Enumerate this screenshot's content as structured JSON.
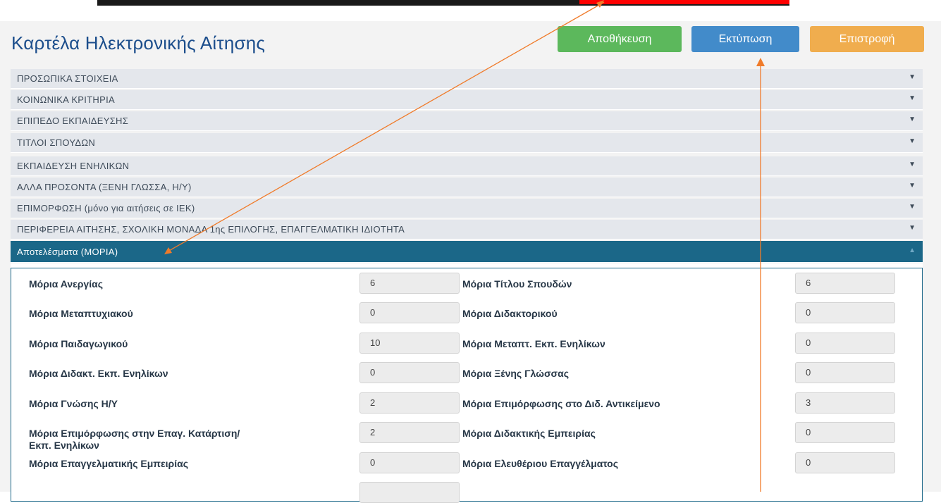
{
  "page": {
    "title": "Καρτέλα Ηλεκτρονικής Αίτησης"
  },
  "toolbar": {
    "save_label": "Αποθήκευση",
    "print_label": "Εκτύπωση",
    "back_label": "Επιστροφή"
  },
  "sections": [
    {
      "label": "ΠΡΟΣΩΠΙΚΑ ΣΤΟΙΧΕΙΑ"
    },
    {
      "label": "ΚΟΙΝΩΝΙΚΑ ΚΡΙΤΗΡΙΑ"
    },
    {
      "label": "ΕΠΙΠΕΔΟ ΕΚΠΑΙΔΕΥΣΗΣ"
    },
    {
      "label": "ΤΙΤΛΟΙ ΣΠΟΥΔΩΝ"
    },
    {
      "label": "ΕΚΠΑΙΔΕΥΣΗ ΕΝΗΛΙΚΩΝ"
    },
    {
      "label": "ΑΛΛΑ ΠΡΟΣΟΝΤΑ (ΞΕΝΗ ΓΛΩΣΣΑ, Η/Υ)"
    },
    {
      "label": "ΕΠΙΜΟΡΦΩΣΗ (μόνο για αιτήσεις σε ΙΕΚ)"
    },
    {
      "label": "ΠΕΡΙΦΕΡΕΙΑ ΑΙΤΗΣΗΣ, ΣΧΟΛΙΚΗ ΜΟΝΑΔΑ 1ης ΕΠΙΛΟΓΗΣ, ΕΠΑΓΓΕΛΜΑΤΙΚΗ ΙΔΙΟΤΗΤΑ"
    },
    {
      "label": "Αποτελέσματα (ΜΟΡΙΑ)"
    }
  ],
  "results": {
    "left": [
      {
        "label": "Μόρια Ανεργίας",
        "value": "6"
      },
      {
        "label": "Μόρια Μεταπτυχιακού",
        "value": "0"
      },
      {
        "label": "Μόρια Παιδαγωγικού",
        "value": "10"
      },
      {
        "label": "Μόρια Διδακτ. Εκπ. Ενηλίκων",
        "value": "0"
      },
      {
        "label": "Μόρια Γνώσης Η/Υ",
        "value": "2"
      },
      {
        "label": "Μόρια Επιμόρφωσης στην Επαγ. Κατάρτιση/",
        "label2": "Εκπ. Ενηλίκων",
        "value": "2"
      },
      {
        "label": "Μόρια Επαγγελματικής Εμπειρίας",
        "value": "0"
      }
    ],
    "right": [
      {
        "label": "Μόρια Τίτλου Σπουδών",
        "value": "6"
      },
      {
        "label": "Μόρια Διδακτορικού",
        "value": "0"
      },
      {
        "label": "Μόρια Μεταπτ. Εκπ. Ενηλίκων",
        "value": "0"
      },
      {
        "label": "Μόρια Ξένης Γλώσσας",
        "value": "0"
      },
      {
        "label": "Μόρια Επιμόρφωσης στο Διδ. Αντικείμενο",
        "value": "3"
      },
      {
        "label": "Μόρια Διδακτικής Εμπειρίας",
        "value": "0"
      },
      {
        "label": "Μόρια Ελευθέριου Επαγγέλματος",
        "value": "0"
      }
    ]
  },
  "colors": {
    "accent": "#1b6788",
    "title": "#1c4e8c",
    "save": "#5cb85c",
    "print": "#428bca",
    "back": "#f0ad4e",
    "annotation_arrow": "#f07b2a",
    "annotation_box": "#ff0000"
  },
  "icons": {
    "collapsed": "caret-down-icon",
    "expanded": "caret-up-icon"
  }
}
